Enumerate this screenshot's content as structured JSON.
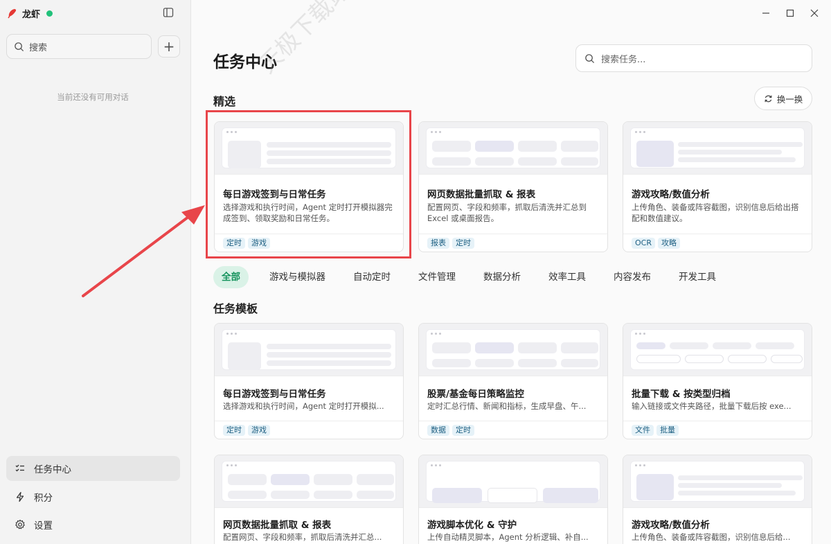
{
  "app": {
    "name": "龙虾",
    "status_color": "#21c17a"
  },
  "sidebar": {
    "search_placeholder": "搜索",
    "add_label": "+",
    "empty_text": "当前还没有可用对话",
    "nav": [
      {
        "label": "任务中心",
        "icon": "checklist-icon",
        "active": true
      },
      {
        "label": "积分",
        "icon": "lightning-icon"
      },
      {
        "label": "设置",
        "icon": "gear-icon"
      }
    ]
  },
  "main": {
    "title": "任务中心",
    "search_placeholder": "搜索任务...",
    "featured_title": "精选",
    "refresh_label": "换一换",
    "featured": [
      {
        "title": "每日游戏签到与日常任务",
        "desc": "选择游戏和执行时间，Agent 定时打开模拟器完成签到、领取奖励和日常任务。",
        "tags": [
          "定时",
          "游戏"
        ]
      },
      {
        "title": "网页数据批量抓取 & 报表",
        "desc": "配置网页、字段和频率，抓取后清洗并汇总到 Excel 或桌面报告。",
        "tags": [
          "报表",
          "定时"
        ]
      },
      {
        "title": "游戏攻略/数值分析",
        "desc": "上传角色、装备或阵容截图，识别信息后给出搭配和数值建议。",
        "tags": [
          "OCR",
          "攻略"
        ]
      }
    ],
    "tabs": [
      "全部",
      "游戏与模拟器",
      "自动定时",
      "文件管理",
      "数据分析",
      "效率工具",
      "内容发布",
      "开发工具"
    ],
    "templates_title": "任务模板",
    "templates": [
      {
        "title": "每日游戏签到与日常任务",
        "desc": "选择游戏和执行时间，Agent 定时打开模拟...",
        "tags": [
          "定时",
          "游戏"
        ]
      },
      {
        "title": "股票/基金每日策略监控",
        "desc": "定时汇总行情、新闻和指标，生成早盘、午...",
        "tags": [
          "数据",
          "定时"
        ]
      },
      {
        "title": "批量下载 & 按类型归档",
        "desc": "输入链接或文件夹路径，批量下载后按 exe...",
        "tags": [
          "文件",
          "批量"
        ]
      },
      {
        "title": "网页数据批量抓取 & 报表",
        "desc": "配置网页、字段和频率，抓取后清洗并汇总...",
        "tags": []
      },
      {
        "title": "游戏脚本优化 & 守护",
        "desc": "上传自动精灵脚本，Agent 分析逻辑、补自...",
        "tags": []
      },
      {
        "title": "游戏攻略/数值分析",
        "desc": "上传角色、装备或阵容截图，识别信息后给...",
        "tags": []
      }
    ]
  },
  "watermark": "天极下载站 down.yesky.com",
  "accent": {
    "green": "#15935d",
    "highlight": "#e8454a"
  }
}
